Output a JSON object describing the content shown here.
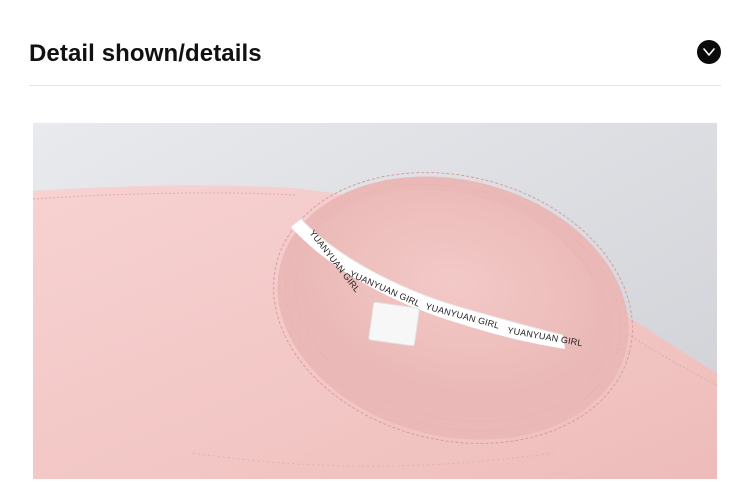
{
  "section": {
    "title": "Detail shown/details",
    "toggle_icon": "chevron-down-icon"
  },
  "photo": {
    "subject": "pink-tshirt-collar",
    "label_text_1": "YUANYUAN GIRL",
    "label_text_2": "YUANYUAN GIRL",
    "label_text_3": "YUANYUAN GIRL",
    "label_text_4": "YUANYUAN GIRL",
    "colors": {
      "shirt": "#f3c9c7",
      "rib": "#ecbab7",
      "background": "#dcdde1",
      "tape": "#ffffff"
    }
  }
}
